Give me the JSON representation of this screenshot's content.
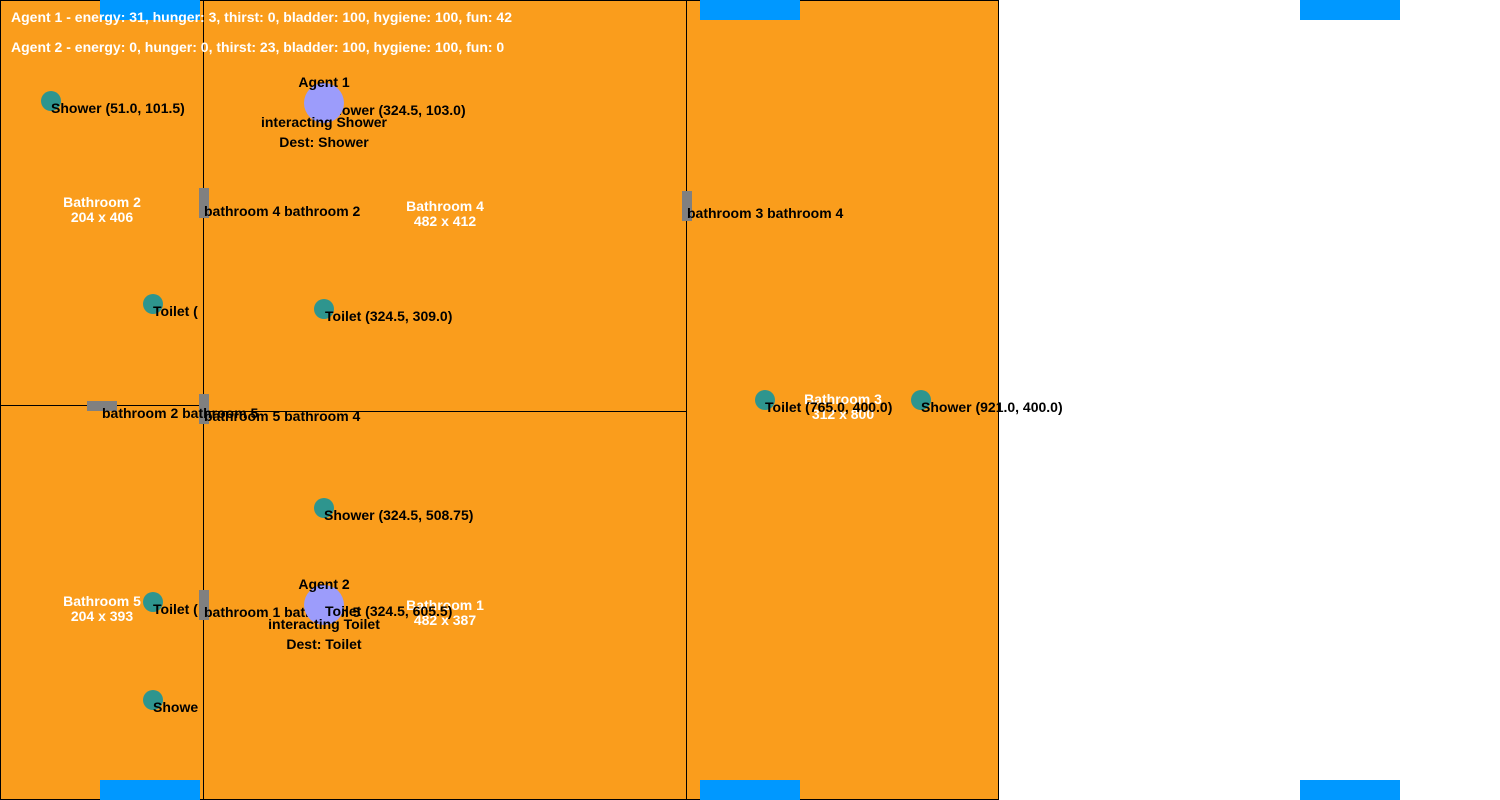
{
  "status": {
    "agent1": "Agent 1 - energy: 31, hunger: 3, thirst: 0, bladder: 100, hygiene: 100, fun: 42",
    "agent2": "Agent 2 - energy: 0, hunger: 0, thirst: 23, bladder: 100, hygiene: 100, fun: 0"
  },
  "rooms": {
    "bathroom2": {
      "name": "Bathroom 2",
      "size": "204 x 406"
    },
    "bathroom4": {
      "name": "Bathroom 4",
      "size": "482 x 412"
    },
    "bathroom3": {
      "name": "Bathroom 3",
      "size": "312 x 800"
    },
    "bathroom5": {
      "name": "Bathroom 5",
      "size": "204 x 393"
    },
    "bathroom1": {
      "name": "Bathroom 1",
      "size": "482 x 387"
    }
  },
  "objects": {
    "shower_b2": "Shower (51.0, 101.5)",
    "shower_b4": "Shower (324.5, 103.0)",
    "toilet_b2": "Toilet (",
    "toilet_b4": "Toilet (324.5, 309.0)",
    "toilet_b3": "Toilet (765.0, 400.0)",
    "shower_b3": "Shower (921.0, 400.0)",
    "shower_b1": "Shower (324.5, 508.75)",
    "toilet_b5": "Toilet (",
    "toilet_b1": "Toilet (324.5, 605.5)",
    "shower_b5": "Showe"
  },
  "doors": {
    "d_b4_b2": "bathroom 4 bathroom 2",
    "d_b3_b4": "bathroom 3 bathroom 4",
    "d_b2_b5": "bathroom 2 bathroom 5",
    "d_b5_b4": "bathroom 5 bathroom 4",
    "d_b1_b5": "bathroom 1 bathroom 5"
  },
  "agents": {
    "agent1": {
      "name": "Agent 1",
      "action": "interacting Shower",
      "dest": "Dest: Shower"
    },
    "agent2": {
      "name": "Agent 2",
      "action": "interacting Toilet",
      "dest": "Dest: Toilet"
    }
  },
  "colors": {
    "room": "#fa9d1c",
    "window": "#0098ff",
    "door": "#808080",
    "object": "#2e958e",
    "agent": "#9c9cfb"
  }
}
